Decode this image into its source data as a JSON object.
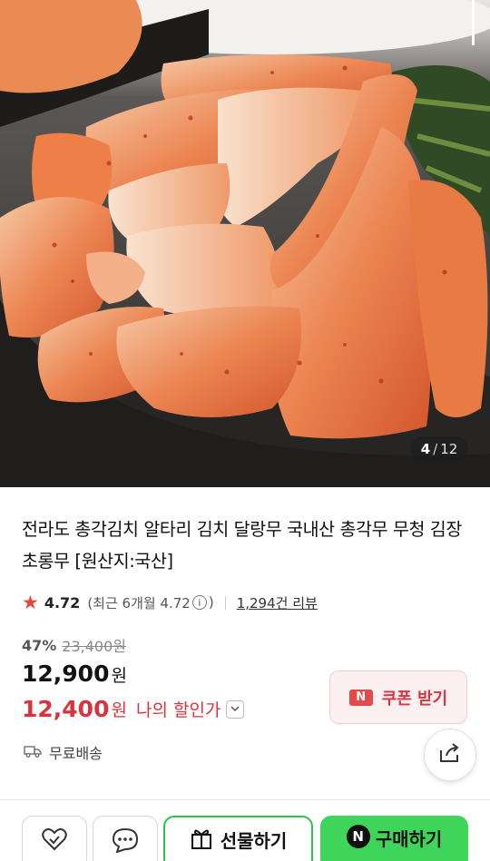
{
  "gallery": {
    "current": "4",
    "separator": "/",
    "total": "12"
  },
  "product": {
    "title": "전라도 총각김치 알타리 김치 달랑무 국내산 총각무 무청 김장 초롱무 [원산지:국산]"
  },
  "rating": {
    "value": "4.72",
    "recent": "(최근 6개월 4.72",
    "info_glyph": "i",
    "recent_close": ")",
    "reviews": "1,294건 리뷰"
  },
  "pricing": {
    "discount": "47%",
    "original": "23,400원",
    "price": "12,900",
    "price_unit": "원",
    "my_price": "12,400",
    "my_price_unit": "원",
    "my_price_label": "나의 할인가"
  },
  "coupon": {
    "badge": "N",
    "label": "쿠폰 받기"
  },
  "shipping": {
    "label": "무료배송"
  },
  "actions": {
    "gift_label": "선물하기",
    "buy_badge": "N",
    "buy_label": "구매하기"
  },
  "colors": {
    "accent_red": "#d9333f",
    "naver_green": "#3fd55b",
    "star": "#e5483b"
  },
  "icons": [
    "star-icon",
    "info-icon",
    "chevron-down-icon",
    "truck-icon",
    "share-icon",
    "heart-icon",
    "chat-icon",
    "gift-icon"
  ]
}
